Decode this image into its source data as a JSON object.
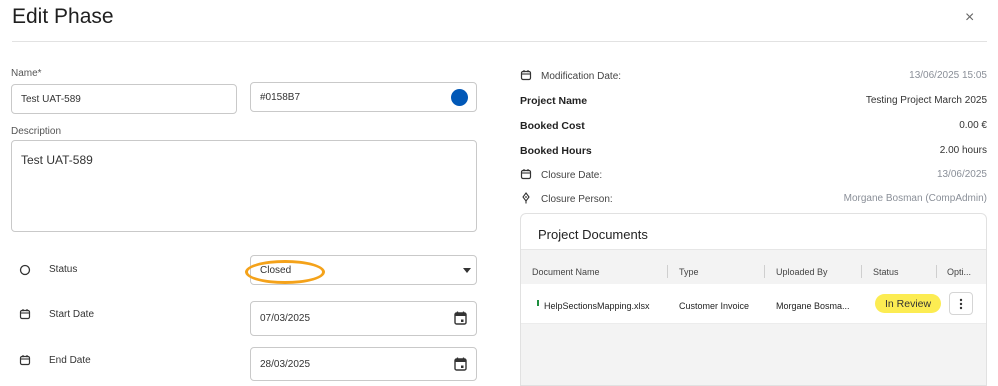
{
  "dialog": {
    "title": "Edit Phase",
    "close_symbol": "×"
  },
  "form": {
    "name_label": "Name*",
    "name_value": "Test UAT-589",
    "color_value": "#0158B7",
    "description_label": "Description",
    "description_value": "Test UAT-589",
    "status_label": "Status",
    "status_value": "Closed",
    "start_date_label": "Start Date",
    "start_date_value": "07/03/2025",
    "end_date_label": "End Date",
    "end_date_value": "28/03/2025"
  },
  "info": {
    "modification_date_label": "Modification Date:",
    "modification_date_value": "13/06/2025 15:05",
    "project_name_label": "Project Name",
    "project_name_value": "Testing Project March 2025",
    "booked_cost_label": "Booked Cost",
    "booked_cost_value": "0.00 €",
    "booked_hours_label": "Booked Hours",
    "booked_hours_value": "2.00 hours",
    "closure_date_label": "Closure Date:",
    "closure_date_value": "13/06/2025",
    "closure_person_label": "Closure Person:",
    "closure_person_value": "Morgane Bosman (CompAdmin)"
  },
  "documents": {
    "title": "Project Documents",
    "columns": [
      "Document Name",
      "Type",
      "Uploaded By",
      "Status",
      "Opti..."
    ],
    "rows": [
      {
        "name": "HelpSectionsMapping.xlsx",
        "type": "Customer Invoice",
        "uploaded_by": "Morgane Bosma...",
        "status": "In Review"
      }
    ]
  },
  "colors": {
    "accent": "#0158B7",
    "highlight_oval": "#f4a21a",
    "status_badge": "#fcec52"
  }
}
